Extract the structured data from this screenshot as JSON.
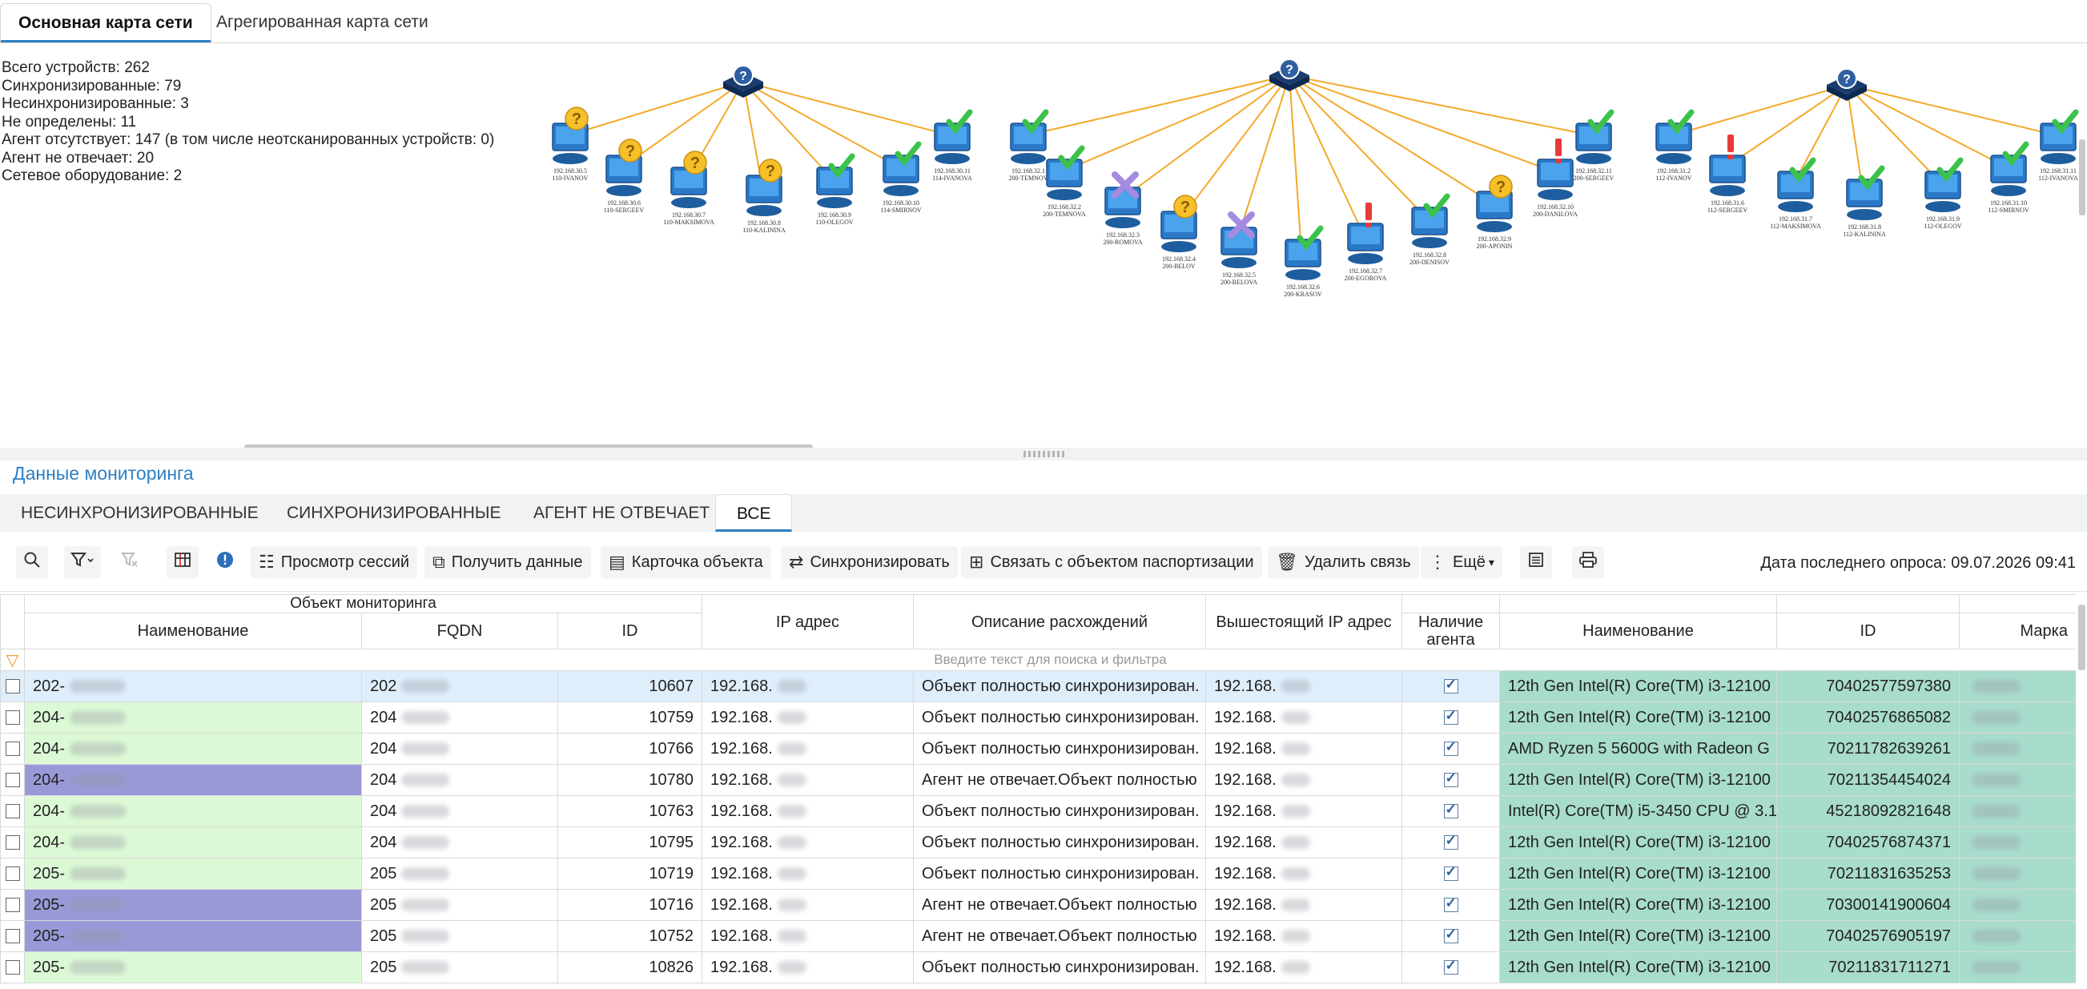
{
  "top_tabs": [
    "Основная карта сети",
    "Агрегированная карта сети"
  ],
  "stats": [
    "Всего устройств: 262",
    "Синхронизированные: 79",
    "Несинхронизированные: 3",
    "Не определены: 11",
    "Агент отсутствует: 147 (в том числе неотсканированных устройств: 0)",
    "Агент не отвечает: 20",
    "Сетевое оборудование: 2"
  ],
  "map_labels": {
    "n1": [
      "192.168.30.5",
      "110-IVANOV"
    ],
    "n2": [
      "192.168.30.6",
      "110-SERGEEV"
    ],
    "n3": [
      "192.168.30.7",
      "110-MAKSIMOVA"
    ],
    "n4": [
      "192.168.30.8",
      "110-KALININA"
    ],
    "n5": [
      "192.168.30.9",
      "110-OLEGOV"
    ],
    "n6": [
      "192.168.30.10",
      "114-SMIRNOV"
    ],
    "n7": [
      "192.168.30.11",
      "114-IVANOVA"
    ],
    "m1": [
      "192.168.32.1",
      "200-TEMNOV"
    ],
    "m2": [
      "192.168.32.2",
      "200-TEMNOVA"
    ],
    "m3": [
      "192.168.32.3",
      "200-ROMOVA"
    ],
    "m4": [
      "192.168.32.4",
      "200-BELOV"
    ],
    "m5": [
      "192.168.32.5",
      "200-BELOVA"
    ],
    "m6": [
      "192.168.32.6",
      "200-KRASOV"
    ],
    "m7": [
      "192.168.32.7",
      "200-EGOROVA"
    ],
    "m8": [
      "192.168.32.8",
      "200-DENISOV"
    ],
    "m9": [
      "192.168.32.9",
      "200-APONIN"
    ],
    "m10": [
      "192.168.32.10",
      "200-DANILOVA"
    ],
    "m11": [
      "192.168.32.11",
      "200-SERGEEV"
    ],
    "k1": [
      "192.168.31.2",
      "112-IVANOV"
    ],
    "k2": [
      "192.168.31.6",
      "112-SERGEEV"
    ],
    "k3": [
      "192.168.31.7",
      "112-MAKSIMOVA"
    ],
    "k4": [
      "192.168.31.8",
      "112-KALININA"
    ],
    "k5": [
      "192.168.31.9",
      "112-OLEGOV"
    ],
    "k6": [
      "192.168.31.10",
      "112-SMIRNOV"
    ],
    "k7": [
      "192.168.31.11",
      "112-IVANOVA"
    ]
  },
  "monitoring_title": "Данные мониторинга",
  "sub_tabs": [
    "НЕСИНХРОНИЗИРОВАННЫЕ",
    "СИНХРОНИЗИРОВАННЫЕ",
    "АГЕНТ НЕ ОТВЕЧАЕТ",
    "ВСЕ"
  ],
  "toolbar": {
    "sessions": "Просмотр сессий",
    "get_data": "Получить данные",
    "card": "Карточка объекта",
    "sync": "Синхронизировать",
    "link": "Связать с объектом паспортизации",
    "unlink": "Удалить связь",
    "more": "Ещё",
    "last_poll": "Дата последнего опроса: 09.07.2026 09:41"
  },
  "grid": {
    "group_header": "Объект мониторинга",
    "headers": [
      "Наименование",
      "FQDN",
      "ID",
      "IP адрес",
      "Описание расхождений",
      "Вышестоящий IP адрес",
      "Наличие агента",
      "Наименование",
      "ID",
      "Марка"
    ],
    "filter_placeholder": "Введите текст для поиска и фильтра",
    "rows": [
      {
        "name": "202-",
        "fqdn": "202",
        "id": "10607",
        "ip": "192.168.",
        "desc": "Объект полностью синхронизирован.",
        "upip": "192.168.",
        "cpu": "12th Gen Intel(R) Core(TM) i3-12100",
        "cid": "70402577597380",
        "state": "blue"
      },
      {
        "name": "204-",
        "fqdn": "204",
        "id": "10759",
        "ip": "192.168.",
        "desc": "Объект полностью синхронизирован.",
        "upip": "192.168.",
        "cpu": "12th Gen Intel(R) Core(TM) i3-12100",
        "cid": "70402576865082",
        "state": "green"
      },
      {
        "name": "204-",
        "fqdn": "204",
        "id": "10766",
        "ip": "192.168.",
        "desc": "Объект полностью синхронизирован.",
        "upip": "192.168.",
        "cpu": "AMD Ryzen 5 5600G with Radeon G",
        "cid": "70211782639261",
        "state": "green"
      },
      {
        "name": "204-",
        "fqdn": "204",
        "id": "10780",
        "ip": "192.168.",
        "desc": "Агент не отвечает.Объект полностью",
        "upip": "192.168.",
        "cpu": "12th Gen Intel(R) Core(TM) i3-12100",
        "cid": "70211354454024",
        "state": "purple"
      },
      {
        "name": "204-",
        "fqdn": "204",
        "id": "10763",
        "ip": "192.168.",
        "desc": "Объект полностью синхронизирован.",
        "upip": "192.168.",
        "cpu": "Intel(R) Core(TM) i5-3450 CPU @ 3.1",
        "cid": "45218092821648",
        "state": "green"
      },
      {
        "name": "204-",
        "fqdn": "204",
        "id": "10795",
        "ip": "192.168.",
        "desc": "Объект полностью синхронизирован.",
        "upip": "192.168.",
        "cpu": "12th Gen Intel(R) Core(TM) i3-12100",
        "cid": "70402576874371",
        "state": "green"
      },
      {
        "name": "205-",
        "fqdn": "205",
        "id": "10719",
        "ip": "192.168.",
        "desc": "Объект полностью синхронизирован.",
        "upip": "192.168.",
        "cpu": "12th Gen Intel(R) Core(TM) i3-12100",
        "cid": "70211831635253",
        "state": "green"
      },
      {
        "name": "205-",
        "fqdn": "205",
        "id": "10716",
        "ip": "192.168.",
        "desc": "Агент не отвечает.Объект полностью",
        "upip": "192.168.",
        "cpu": "12th Gen Intel(R) Core(TM) i3-12100",
        "cid": "70300141900604",
        "state": "purple"
      },
      {
        "name": "205-",
        "fqdn": "205",
        "id": "10752",
        "ip": "192.168.",
        "desc": "Агент не отвечает.Объект полностью",
        "upip": "192.168.",
        "cpu": "12th Gen Intel(R) Core(TM) i3-12100",
        "cid": "70402576905197",
        "state": "purple"
      },
      {
        "name": "205-",
        "fqdn": "205",
        "id": "10826",
        "ip": "192.168.",
        "desc": "Объект полностью синхронизирован.",
        "upip": "192.168.",
        "cpu": "12th Gen Intel(R) Core(TM) i3-12100",
        "cid": "70211831711271",
        "state": "green"
      }
    ]
  }
}
